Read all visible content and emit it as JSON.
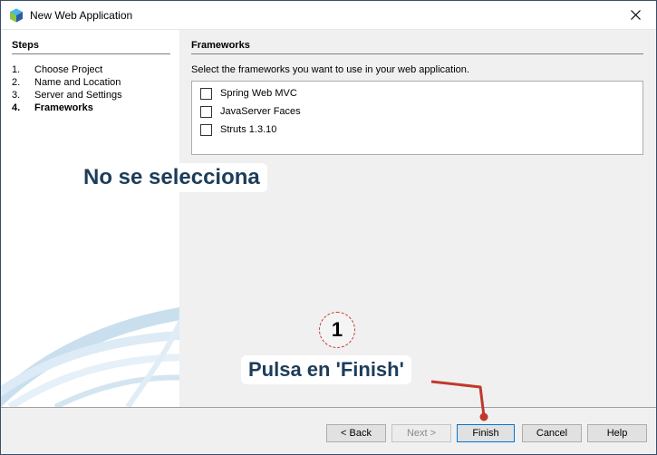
{
  "window": {
    "title": "New Web Application"
  },
  "steps": {
    "title": "Steps",
    "items": [
      {
        "num": "1.",
        "label": "Choose Project"
      },
      {
        "num": "2.",
        "label": "Name and Location"
      },
      {
        "num": "3.",
        "label": "Server and Settings"
      },
      {
        "num": "4.",
        "label": "Frameworks"
      }
    ],
    "active_index": 3
  },
  "frameworks": {
    "title": "Frameworks",
    "description": "Select the frameworks you want to use in your web application.",
    "items": [
      {
        "label": "Spring Web MVC",
        "checked": false
      },
      {
        "label": "JavaServer Faces",
        "checked": false
      },
      {
        "label": "Struts 1.3.10",
        "checked": false
      }
    ]
  },
  "buttons": {
    "back": "< Back",
    "next": "Next >",
    "finish": "Finish",
    "cancel": "Cancel",
    "help": "Help"
  },
  "annotations": {
    "no_select": "No se selecciona",
    "step_number": "1",
    "click_finish": "Pulsa en 'Finish'"
  },
  "colors": {
    "annotation_text": "#1c3d5a",
    "arrow": "#c0392b",
    "default_button_border": "#0078d7"
  }
}
